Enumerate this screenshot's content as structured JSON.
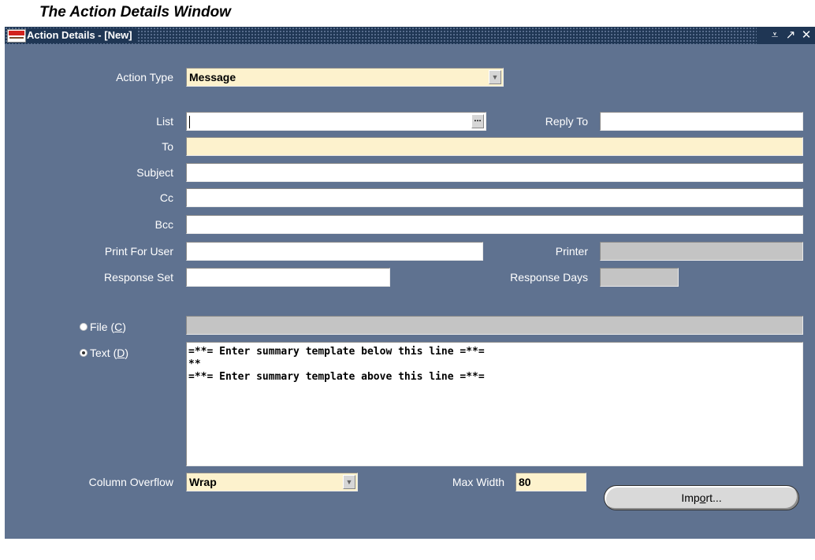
{
  "caption": "The Action Details Window",
  "window": {
    "title": "Action Details - [New]",
    "app_icon": "oracle-app-icon",
    "controls": [
      "minimize-icon",
      "maximize-icon",
      "close-icon"
    ]
  },
  "action_type": {
    "label": "Action Type",
    "value": "Message"
  },
  "list": {
    "label": "List",
    "value": ""
  },
  "reply_to": {
    "label": "Reply To",
    "value": ""
  },
  "to": {
    "label": "To",
    "value": ""
  },
  "subject": {
    "label": "Subject",
    "value": ""
  },
  "cc": {
    "label": "Cc",
    "value": ""
  },
  "bcc": {
    "label": "Bcc",
    "value": ""
  },
  "print_for_user": {
    "label": "Print For User",
    "value": ""
  },
  "printer": {
    "label": "Printer",
    "value": ""
  },
  "response_set": {
    "label": "Response Set",
    "value": ""
  },
  "response_days": {
    "label": "Response Days",
    "value": ""
  },
  "file_option": {
    "label_prefix": "File (",
    "mnemonic": "C",
    "label_suffix": ")",
    "selected": false
  },
  "text_option": {
    "label_prefix": "Text (",
    "mnemonic": "D",
    "label_suffix": ")",
    "selected": true
  },
  "text_body": {
    "lines": [
      "=**= Enter summary template below this line =**=",
      "**",
      "=**= Enter summary template above this line =**="
    ]
  },
  "column_overflow": {
    "label": "Column Overflow",
    "value": "Wrap"
  },
  "max_width": {
    "label": "Max Width",
    "value": "80"
  },
  "import_button": {
    "prefix": "Imp",
    "mnemonic": "o",
    "suffix": "rt..."
  }
}
